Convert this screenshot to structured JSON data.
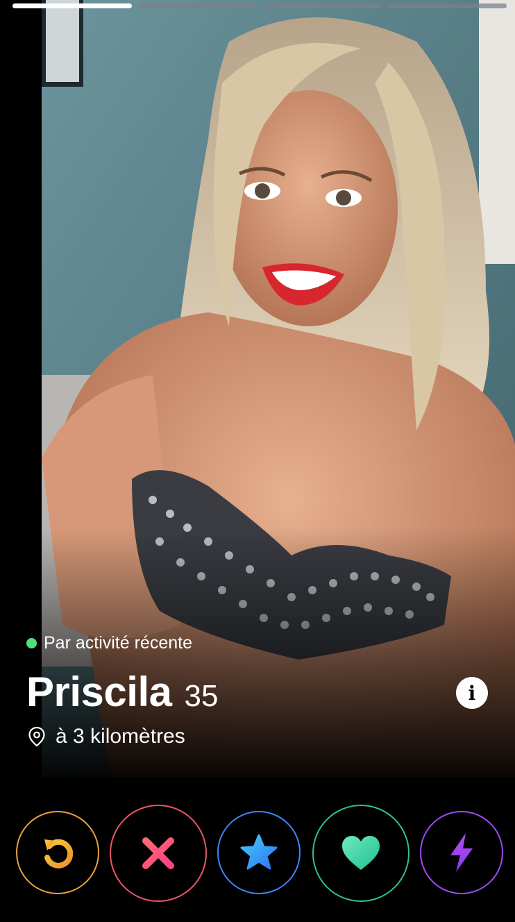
{
  "progress": {
    "total": 4,
    "active_index": 0
  },
  "profile": {
    "activity_label": "Par activité récente",
    "name": "Priscila",
    "age": "35",
    "distance": "à 3 kilomètres"
  },
  "info_button": {
    "glyph": "i",
    "icon": "info-icon"
  },
  "actions": [
    {
      "name": "rewind-button",
      "icon": "rewind-icon",
      "color": "#e8a33c"
    },
    {
      "name": "nope-button",
      "icon": "close-icon",
      "color": "#f1546a"
    },
    {
      "name": "super-like-button",
      "icon": "star-icon",
      "color": "#3f86f7"
    },
    {
      "name": "like-button",
      "icon": "heart-icon",
      "color": "#2fc387"
    },
    {
      "name": "boost-button",
      "icon": "bolt-icon",
      "color": "#a149f2"
    }
  ],
  "colors": {
    "online_dot": "#4ee07f",
    "progress_active": "#ffffff",
    "progress_inactive": "#6f7882"
  }
}
